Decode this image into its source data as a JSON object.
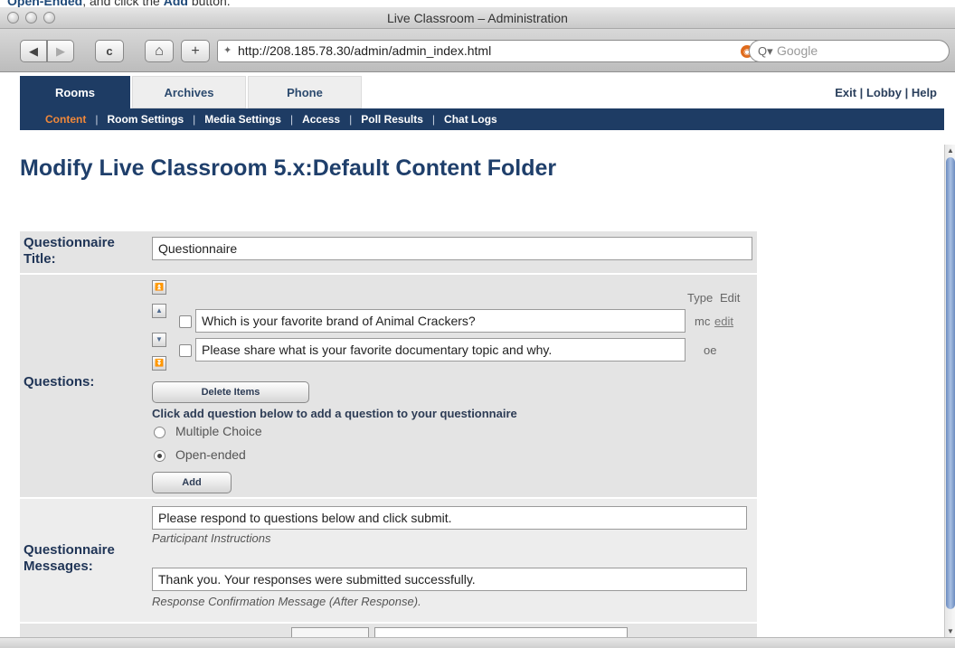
{
  "instruction": {
    "text_a": "Open-Ended",
    "text_b": ", and click the ",
    "text_c": "Add",
    "text_d": " button."
  },
  "window": {
    "title": "Live Classroom – Administration"
  },
  "toolbar": {
    "back_glyph": "◀",
    "forward_glyph": "▶",
    "reload_glyph": "c",
    "home_glyph": "⌂",
    "add_glyph": "+",
    "url": "http://208.185.78.30/admin/admin_index.html",
    "search_placeholder": "Google"
  },
  "tabs": [
    {
      "label": "Rooms",
      "active": true
    },
    {
      "label": "Archives",
      "active": false
    },
    {
      "label": "Phone",
      "active": false
    }
  ],
  "toplinks": {
    "exit": "Exit",
    "lobby": "Lobby",
    "help": "Help",
    "sep": "|"
  },
  "subnav": [
    "Content",
    "Room Settings",
    "Media Settings",
    "Access",
    "Poll Results",
    "Chat Logs"
  ],
  "heading": "Modify Live Classroom 5.x:Default Content Folder",
  "form": {
    "title_label": "Questionnaire Title:",
    "title_value": "Questionnaire",
    "questions_label": "Questions:",
    "col_type": "Type",
    "col_edit": "Edit",
    "questions": [
      {
        "text": "Which is your favorite brand of Animal Crackers?",
        "type": "mc",
        "edit": "edit"
      },
      {
        "text": "Please share what is your favorite documentary topic and why.",
        "type": "oe",
        "edit": ""
      }
    ],
    "delete_button": "Delete Items",
    "add_hint": "Click add question below to add a question to your questionnaire",
    "radio_options": [
      {
        "label": "Multiple Choice",
        "selected": false
      },
      {
        "label": "Open-ended",
        "selected": true
      }
    ],
    "add_button": "Add",
    "messages_label": "Questionnaire Messages:",
    "instructions_value": "Please respond to questions below and click submit.",
    "instructions_caption": "Participant Instructions",
    "confirmation_value": "Thank you.  Your responses were submitted successfully.",
    "confirmation_caption": "Response Confirmation Message (After Response)."
  }
}
